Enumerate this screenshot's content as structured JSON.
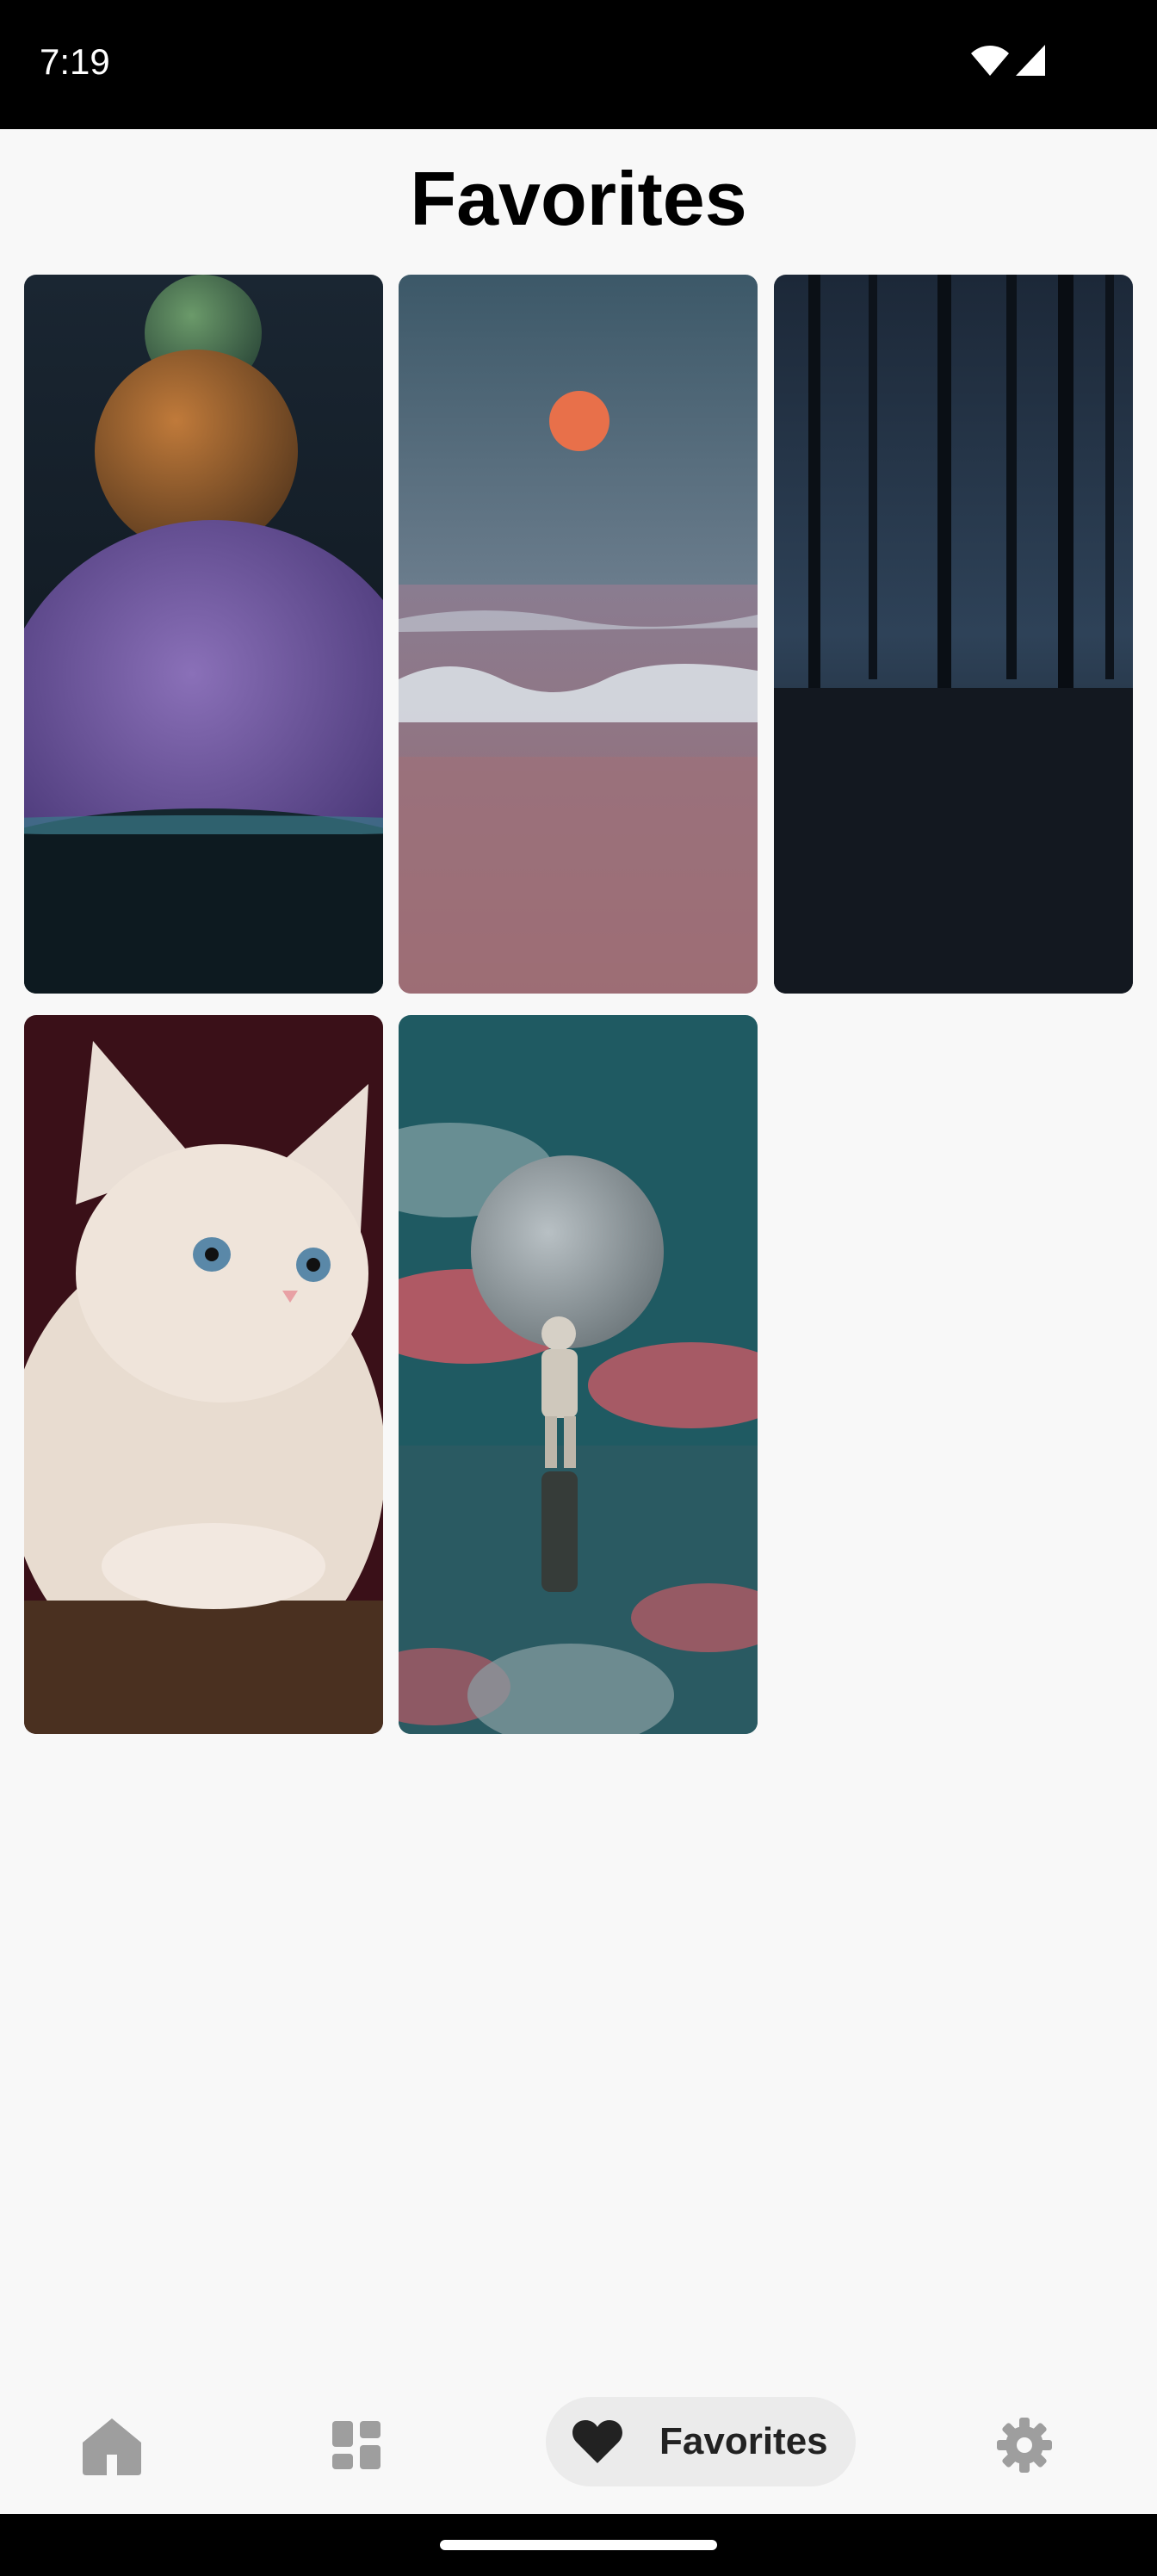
{
  "status_bar": {
    "time": "7:19"
  },
  "header": {
    "title": "Favorites"
  },
  "favorites": [
    {
      "name": "planets"
    },
    {
      "name": "moon-sea"
    },
    {
      "name": "dark-forest"
    },
    {
      "name": "kitten"
    },
    {
      "name": "astronaut-moon"
    }
  ],
  "nav": {
    "items": [
      {
        "icon": "home-icon"
      },
      {
        "icon": "categories-icon"
      },
      {
        "icon": "heart-icon",
        "label": "Favorites",
        "active": true
      },
      {
        "icon": "settings-icon"
      }
    ]
  },
  "colors": {
    "background": "#f8f8f8",
    "icon_inactive": "#9e9e9e",
    "pill": "#ebebeb"
  }
}
